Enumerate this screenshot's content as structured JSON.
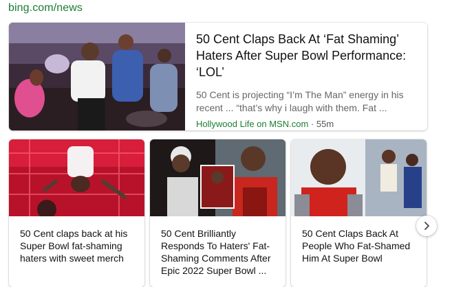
{
  "source": {
    "url": "bing.com/news"
  },
  "featured": {
    "headline": "50 Cent Claps Back At ‘Fat Shaming’ Haters After Super Bowl Performance: ‘LOL’",
    "snippet": "50 Cent is projecting “I’m The Man” energy in his recent ... “that’s why i laugh with them. Fat ...",
    "publisher": "Hollywood Life on MSN.com",
    "separator": " · ",
    "age": "55m"
  },
  "cards": [
    {
      "headline": "50 Cent claps back at his Super Bowl fat-shaming haters with sweet merch"
    },
    {
      "headline": "50 Cent Brilliantly Responds To Haters' Fat-Shaming Comments After Epic 2022 Super Bowl ..."
    },
    {
      "headline": "50 Cent Claps Back At People Who Fat-Shamed Him At Super Bowl"
    }
  ],
  "icons": {
    "next": "chevron-right-icon"
  },
  "colors": {
    "publisher": "#1a7d31",
    "url": "#1a7d31",
    "headline": "#111111",
    "snippet": "#666666"
  }
}
